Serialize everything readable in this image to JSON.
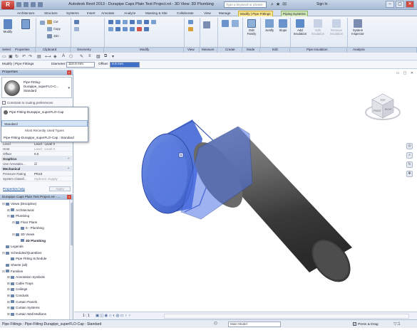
{
  "titlebar": {
    "app_logo": "R",
    "title": "Autodesk Revit 2013 - Durapipe Caps Plain Test Project.rvt - 3D View: 3D Plumbing",
    "search_placeholder": "Type a keyword or phrase",
    "signin": "Sign In",
    "controls": {
      "minimize": "–",
      "restore": "▢",
      "close": "✕"
    }
  },
  "tabs": [
    {
      "label": "Architecture"
    },
    {
      "label": "Structure"
    },
    {
      "label": "Systems"
    },
    {
      "label": "Insert"
    },
    {
      "label": "Annotate"
    },
    {
      "label": "Analyze"
    },
    {
      "label": "Massing & Site"
    },
    {
      "label": "Collaborate"
    },
    {
      "label": "View"
    },
    {
      "label": "Manage"
    },
    {
      "label": "Modify | Pipe Fittings"
    },
    {
      "label": "Piping Systems"
    }
  ],
  "ribbon": {
    "modify_label": "Modify",
    "properties_label": "Properties",
    "clipboard": {
      "cut": "Cut",
      "copy": "Copy",
      "join": "Join"
    },
    "edit_family": "Edit Family",
    "justify": "Justify",
    "slope": "Slope",
    "add_insulation": "Add Insulation",
    "edit_insulation": "Edit Insulation",
    "remove_insulation": "Remove Insulation",
    "system_inspector": "System Inspector",
    "panels": [
      "Select",
      "Properties",
      "Clipboard",
      "Geometry",
      "Modify",
      "View",
      "Measure",
      "Create",
      "Mode",
      "Edit",
      "Pipe Insulation",
      "Analysis"
    ]
  },
  "options_bar": {
    "context": "Modify | Pipe Fittings",
    "diameter_label": "Diameter:",
    "diameter_value": "110.0 mm",
    "offset_label": "Offset:",
    "offset_value": "0.0 mm"
  },
  "properties": {
    "header": "Properties",
    "type_name": "Pipe-Fitting-Durapipe_superFLO-C... Standard",
    "constrain": "Constrain to routing preferences",
    "dropdown": {
      "current": "Pipe-Fitting-Durapipe_superFLO-Cap",
      "selected": "Standard",
      "mru_header": "Most Recently Used Types",
      "mru_item": "Pipe-Fitting-Durapipe_superFLO-Cap : Standard"
    },
    "rows": [
      {
        "k": "Level",
        "v": "Level : Level 0"
      },
      {
        "k": "Host",
        "v": "Level : Level 0"
      },
      {
        "k": "Offset",
        "v": "0.0"
      }
    ],
    "graphics_group": "Graphics",
    "annotation_row": {
      "k": "Use Annotatio...",
      "v": "☑"
    },
    "mechanical_group": "Mechanical",
    "mech_rows": [
      {
        "k": "Pressure Rating",
        "v": "PN10"
      },
      {
        "k": "System Classif...",
        "v": "Hydronic Supply"
      }
    ],
    "help_link": "Properties help",
    "apply": "Apply"
  },
  "browser": {
    "header": "Durapipe Caps Plain Test Project.rvt - ...",
    "items": [
      {
        "label": "Views (Discipline)",
        "toggle": "⊟",
        "indent": 0,
        "bold": false
      },
      {
        "label": "Architectural",
        "toggle": "⊞",
        "indent": 1,
        "bold": false
      },
      {
        "label": "Plumbing",
        "toggle": "⊟",
        "indent": 1,
        "bold": false
      },
      {
        "label": "Floor Plans",
        "toggle": "⊟",
        "indent": 2,
        "bold": false
      },
      {
        "label": "0 - Plumbing",
        "toggle": "",
        "indent": 3,
        "bold": false
      },
      {
        "label": "3D Views",
        "toggle": "⊟",
        "indent": 2,
        "bold": false
      },
      {
        "label": "3D Plumbing",
        "toggle": "",
        "indent": 3,
        "bold": true
      },
      {
        "label": "Legends",
        "toggle": "",
        "indent": 0,
        "bold": false
      },
      {
        "label": "Schedules/Quantities",
        "toggle": "⊟",
        "indent": 0,
        "bold": false
      },
      {
        "label": "Pipe Fitting Schedule",
        "toggle": "",
        "indent": 1,
        "bold": false
      },
      {
        "label": "Sheets (all)",
        "toggle": "",
        "indent": 0,
        "bold": false
      },
      {
        "label": "Families",
        "toggle": "⊟",
        "indent": 0,
        "bold": false
      },
      {
        "label": "Annotation Symbols",
        "toggle": "⊞",
        "indent": 1,
        "bold": false
      },
      {
        "label": "Cable Trays",
        "toggle": "⊞",
        "indent": 1,
        "bold": false
      },
      {
        "label": "Ceilings",
        "toggle": "⊞",
        "indent": 1,
        "bold": false
      },
      {
        "label": "Conduits",
        "toggle": "⊞",
        "indent": 1,
        "bold": false
      },
      {
        "label": "Curtain Panels",
        "toggle": "⊞",
        "indent": 1,
        "bold": false
      },
      {
        "label": "Curtain Systems",
        "toggle": "⊞",
        "indent": 1,
        "bold": false
      },
      {
        "label": "Curtain Wall Mullions",
        "toggle": "⊞",
        "indent": 1,
        "bold": false
      }
    ]
  },
  "viewcube": {
    "top": "TOP",
    "front": "FRONT",
    "right": "RIGHT"
  },
  "viewbar": {
    "scale": "1 : 1"
  },
  "status": {
    "text": "Pipe Fittings : Pipe-Fitting-Durapipe_superFLO-Cap : Standard",
    "model": "Main Model",
    "press_drag": "Press & Drag",
    "filter": "▽:1"
  }
}
